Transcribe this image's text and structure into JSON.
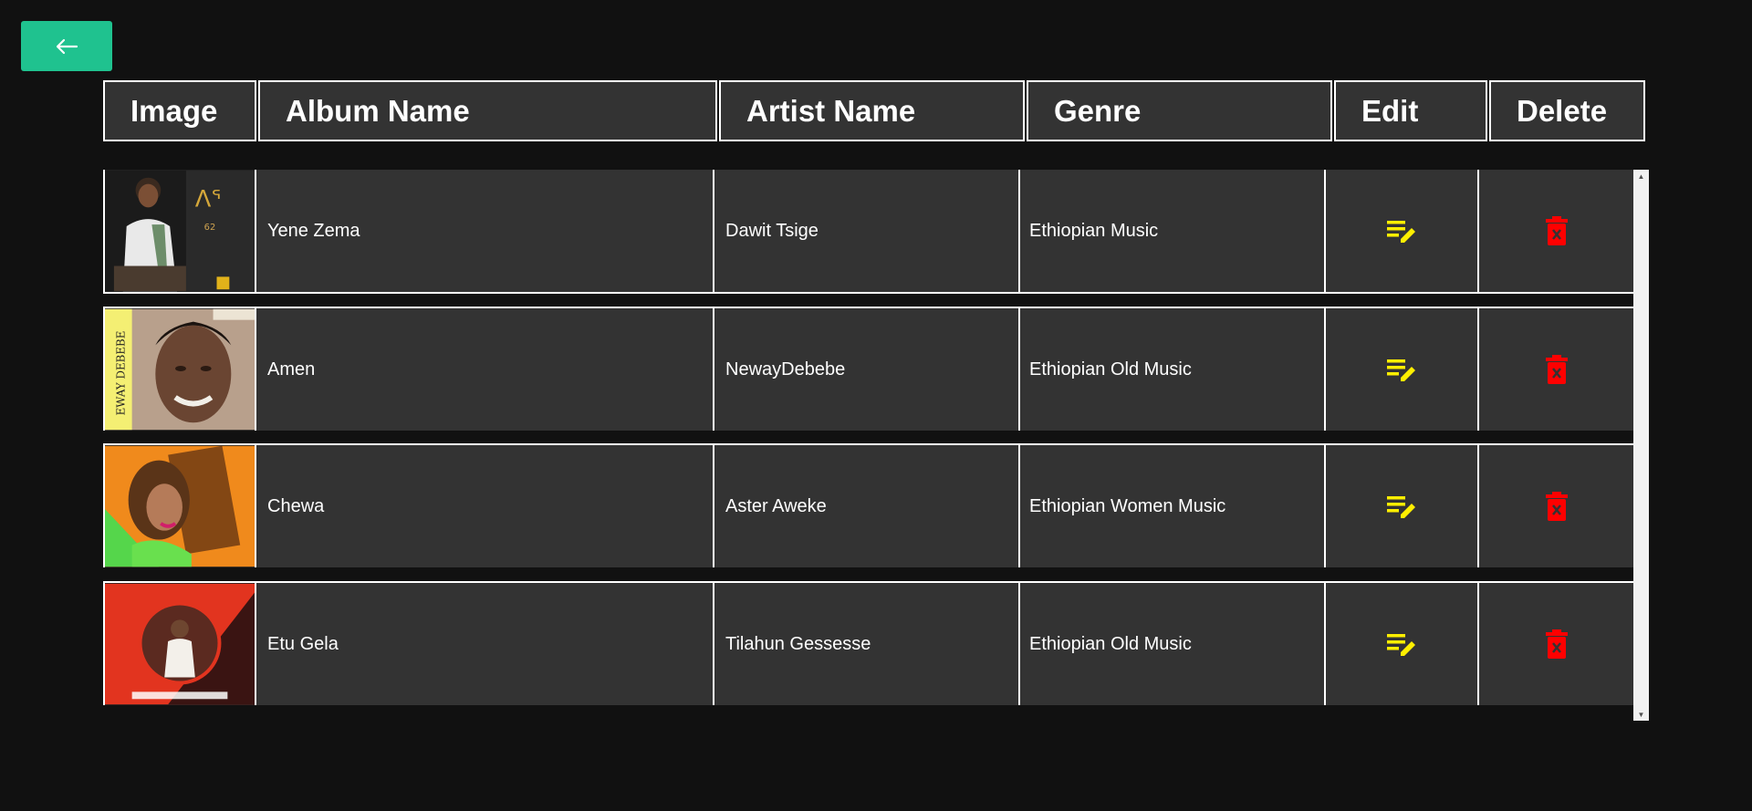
{
  "back_button": {
    "icon": "arrow-left-icon"
  },
  "table": {
    "headers": [
      "Image",
      "Album Name",
      "Artist Name",
      "Genre",
      "Edit",
      "Delete"
    ],
    "rows": [
      {
        "image": "album-cover",
        "album": "Yene Zema",
        "artist": "Dawit Tsige",
        "genre": "Ethiopian Music",
        "edit_icon": "edit-icon",
        "delete_icon": "delete-icon"
      },
      {
        "image": "album-cover",
        "album": "Amen",
        "artist": "NewayDebebe",
        "genre": "Ethiopian Old Music",
        "edit_icon": "edit-icon",
        "delete_icon": "delete-icon"
      },
      {
        "image": "album-cover",
        "album": "Chewa",
        "artist": "Aster Aweke",
        "genre": "Ethiopian Women Music",
        "edit_icon": "edit-icon",
        "delete_icon": "delete-icon"
      },
      {
        "image": "album-cover",
        "album": "Etu Gela",
        "artist": "Tilahun Gessesse",
        "genre": "Ethiopian Old Music",
        "edit_icon": "edit-icon",
        "delete_icon": "delete-icon"
      }
    ]
  },
  "colors": {
    "background": "#111111",
    "cell_background": "#333333",
    "accent": "#1fc28f",
    "edit": "#ffef00",
    "delete": "#ff0000"
  }
}
